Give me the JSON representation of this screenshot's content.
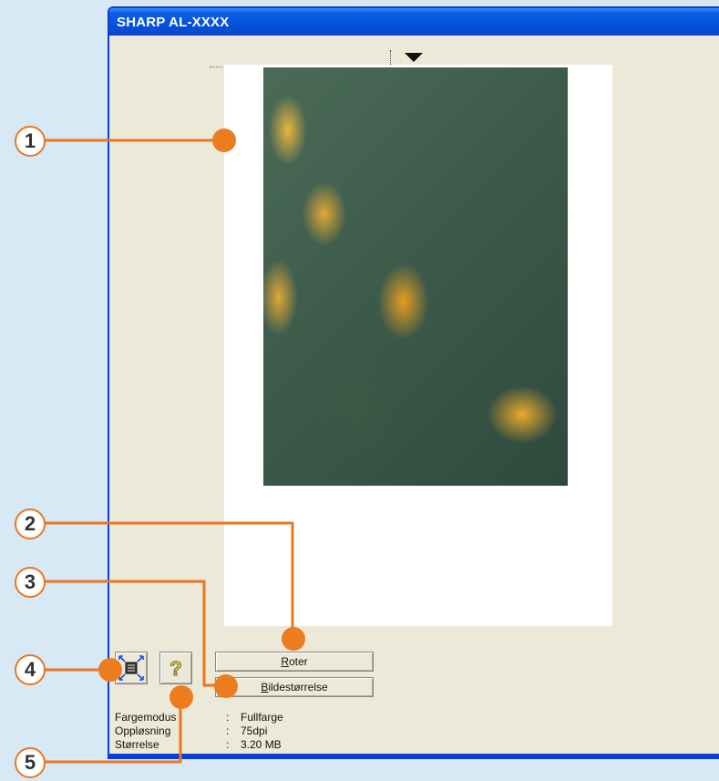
{
  "window": {
    "title": "SHARP AL-XXXX"
  },
  "buttons": {
    "rotate": "Roter",
    "rotate_mnemonic": "R",
    "size": "Bildestørrelse",
    "size_mnemonic": "B"
  },
  "info": [
    {
      "label": "Fargemodus",
      "sep": ":",
      "value": "Fullfarge"
    },
    {
      "label": "Oppløsning",
      "sep": ":",
      "value": "75dpi"
    },
    {
      "label": "Størrelse",
      "sep": ":",
      "value": "3.20 MB"
    }
  ],
  "callouts": [
    "1",
    "2",
    "3",
    "4",
    "5"
  ],
  "colors": {
    "accent": "#e87722",
    "titlebar": "#0d5fe6",
    "background": "#d6e9f4"
  },
  "icons": {
    "fit": "fit-to-window-icon",
    "help": "help-question-icon"
  }
}
